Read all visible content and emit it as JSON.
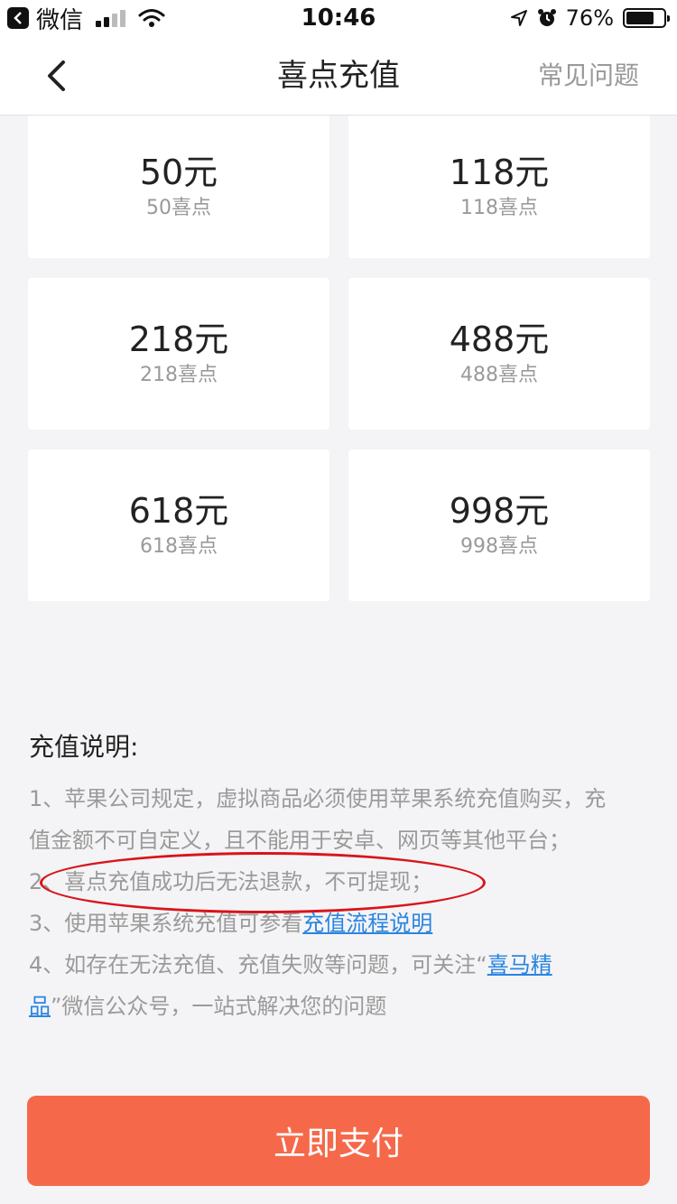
{
  "status_bar": {
    "app_name": "微信",
    "time": "10:46",
    "battery_percent": "76%",
    "battery_level": 0.76
  },
  "nav": {
    "title": "喜点充值",
    "faq_label": "常见问题"
  },
  "packages": [
    {
      "price": "50元",
      "points": "50喜点"
    },
    {
      "price": "118元",
      "points": "118喜点"
    },
    {
      "price": "218元",
      "points": "218喜点"
    },
    {
      "price": "488元",
      "points": "488喜点"
    },
    {
      "price": "618元",
      "points": "618喜点"
    },
    {
      "price": "998元",
      "points": "998喜点"
    }
  ],
  "instructions": {
    "title": "充值说明:",
    "line1_a": "1、苹果公司规定，虚拟商品必须使用苹果系统充值购买，充",
    "line1_b": "值金额不可自定义，且不能用于安卓、网页等其他平台；",
    "line2": "2、喜点充值成功后无法退款，不可提现；",
    "line3_text": "3、使用苹果系统充值可参看",
    "line3_link": "充值流程说明",
    "line4_text": "4、如存在无法充值、充值失败等问题，可关注“",
    "line4_link_a": "喜马精",
    "line4_link_b": "品",
    "line4_tail": "”微信公众号，一站式解决您的问题"
  },
  "pay_button": {
    "label": "立即支付",
    "color": "#f5694a"
  }
}
